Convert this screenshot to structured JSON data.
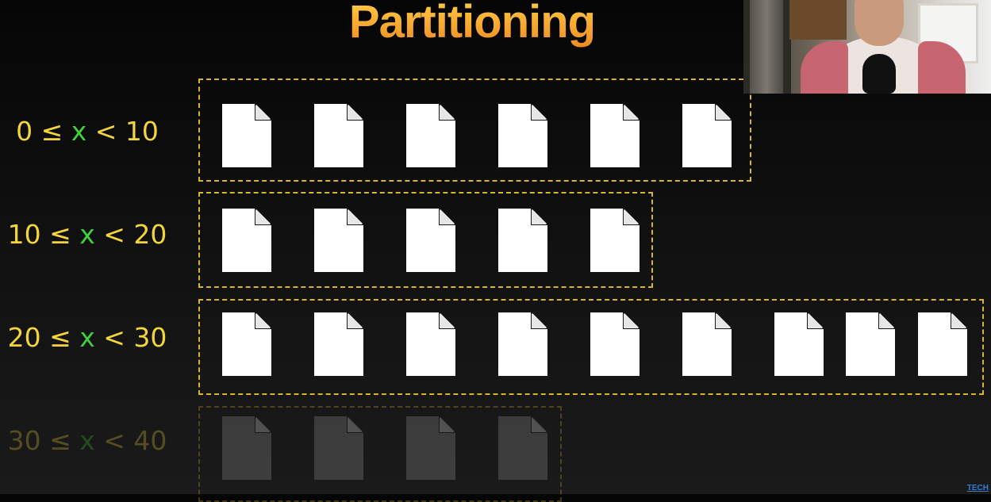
{
  "title": "Partitioning",
  "partitions": [
    {
      "label_left": "0 ≤",
      "label_var": "x",
      "label_right": "< 10",
      "files": 6
    },
    {
      "label_left": "10 ≤",
      "label_var": "x",
      "label_right": "< 20",
      "files": 5
    },
    {
      "label_left": "20 ≤",
      "label_var": "x",
      "label_right": "< 30",
      "files": 9
    },
    {
      "label_left": "30 ≤",
      "label_var": "x",
      "label_right": "< 40",
      "files": 4
    }
  ],
  "watermark": "TECH",
  "colors": {
    "title": "#f6a531",
    "label": "#f2d43c",
    "variable": "#3fcf3f",
    "border": "#d7b629",
    "file": "#ffffff"
  }
}
